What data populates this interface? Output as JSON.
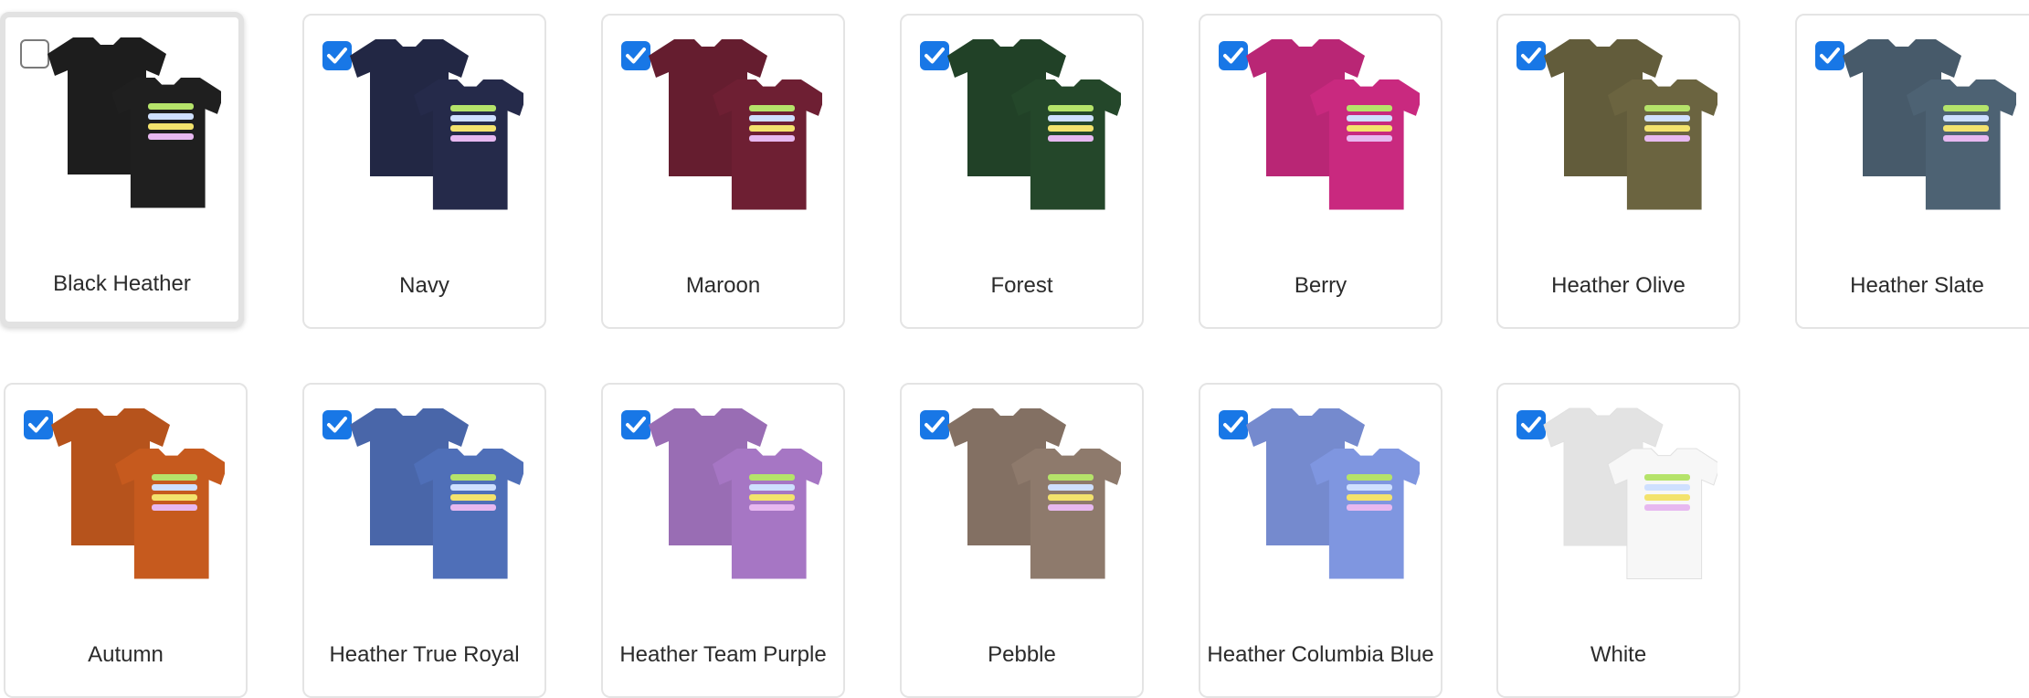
{
  "colors": {
    "accent": "#1877e6",
    "card_border": "#e4e4e4",
    "label_text": "#2b2b2b"
  },
  "variants": [
    {
      "label": "Black Heather",
      "checked": false,
      "shirt_color": "#1f1f1f",
      "focused": true
    },
    {
      "label": "Navy",
      "checked": true,
      "shirt_color": "#252a4a"
    },
    {
      "label": "Maroon",
      "checked": true,
      "shirt_color": "#6e1f33"
    },
    {
      "label": "Forest",
      "checked": true,
      "shirt_color": "#24472a"
    },
    {
      "label": "Berry",
      "checked": true,
      "shirt_color": "#c9297f"
    },
    {
      "label": "Heather Olive",
      "checked": true,
      "shirt_color": "#6b6440"
    },
    {
      "label": "Heather Slate",
      "checked": true,
      "shirt_color": "#4d6273"
    },
    {
      "label": "Autumn",
      "checked": true,
      "shirt_color": "#c65a1e"
    },
    {
      "label": "Heather True Royal",
      "checked": true,
      "shirt_color": "#4f6fb8"
    },
    {
      "label": "Heather Team Purple",
      "checked": true,
      "shirt_color": "#a676c4"
    },
    {
      "label": "Pebble",
      "checked": true,
      "shirt_color": "#8e7a6c"
    },
    {
      "label": "Heather Columbia Blue",
      "checked": true,
      "shirt_color": "#7f96e0"
    },
    {
      "label": "White",
      "checked": true,
      "shirt_color": "#f7f7f7"
    }
  ]
}
